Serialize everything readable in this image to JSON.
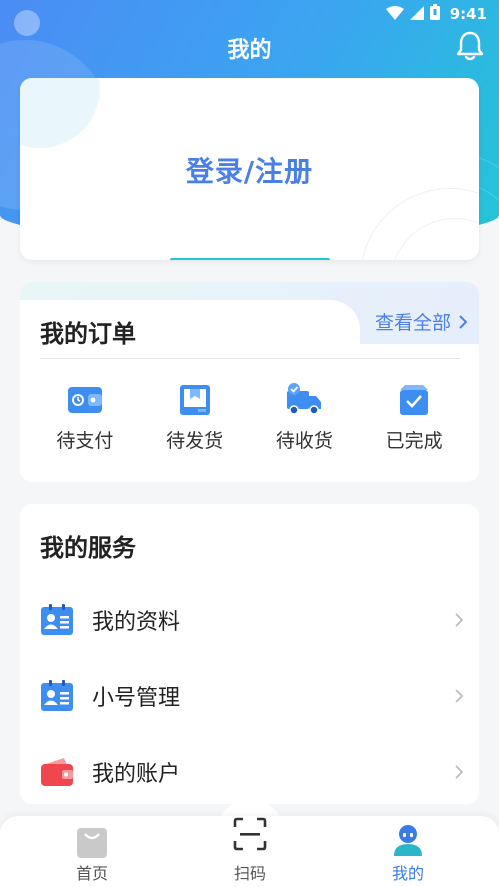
{
  "status_bar": {
    "time": "9:41"
  },
  "header": {
    "title": "我的"
  },
  "login": {
    "label": "登录/注册"
  },
  "orders": {
    "title": "我的订单",
    "view_all": "查看全部",
    "items": [
      {
        "label": "待支付",
        "icon": "wallet-icon"
      },
      {
        "label": "待发货",
        "icon": "package-icon"
      },
      {
        "label": "待收货",
        "icon": "truck-icon"
      },
      {
        "label": "已完成",
        "icon": "completed-box-icon"
      }
    ]
  },
  "services": {
    "title": "我的服务",
    "items": [
      {
        "label": "我的资料",
        "icon": "profile-card-icon"
      },
      {
        "label": "小号管理",
        "icon": "sub-account-card-icon"
      },
      {
        "label": "我的账户",
        "icon": "red-wallet-icon"
      }
    ]
  },
  "bottom_nav": {
    "items": [
      {
        "label": "首页",
        "icon": "shopping-bag-icon"
      },
      {
        "label": "扫码",
        "icon": "scan-icon"
      },
      {
        "label": "我的",
        "icon": "user-icon"
      }
    ],
    "active_index": 2
  },
  "colors": {
    "accent": "#4a7fe8",
    "header_gradient_start": "#4b8cf5",
    "header_gradient_end": "#22c6d6",
    "order_icon_blue": "#3d8ef0",
    "wallet_red": "#f0474f"
  }
}
